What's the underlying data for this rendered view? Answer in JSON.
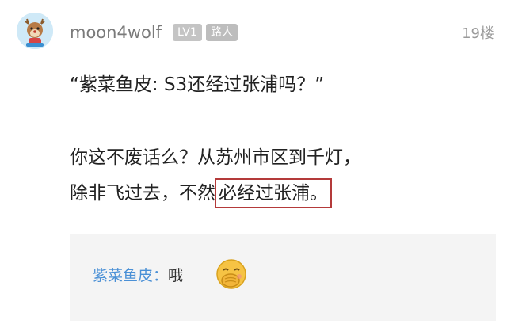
{
  "post": {
    "username": "moon4wolf",
    "level_badge": "LV1",
    "role_badge": "路人",
    "floor": "19楼",
    "quote": "“紫菜鱼皮: S3还经过张浦吗？”",
    "body_line1": "你这不废话么？从苏州市区到千灯，",
    "body_line2_prefix": "除非飞过去，不然",
    "body_line2_highlight": "必经过张浦。"
  },
  "reply": {
    "name": "紫菜鱼皮：",
    "text": "哦",
    "emoji": "face-with-hand-over-mouth-icon"
  },
  "colors": {
    "highlight_border": "#b43a3a",
    "reply_name": "#4a90d6",
    "badge_bg": "#c4c4c4"
  }
}
